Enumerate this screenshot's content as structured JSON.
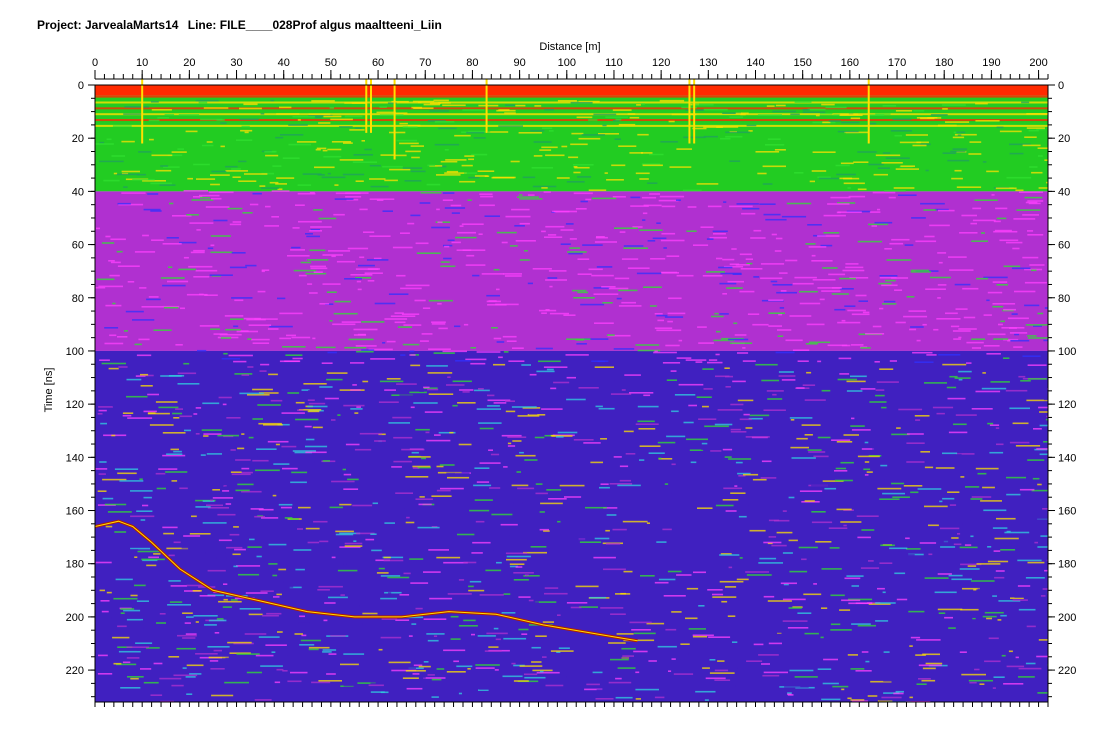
{
  "header": {
    "project": "Project: JarvealaMarts14",
    "line": "Line: FILE____028Prof algus maaltteeni_Liin"
  },
  "chart_data": {
    "type": "heatmap",
    "title": "",
    "xlabel": "Distance [m]",
    "ylabel": "Time [ns]",
    "xlim": [
      0,
      202
    ],
    "ylim": [
      0,
      232
    ],
    "x_ticks": [
      0,
      10,
      20,
      30,
      40,
      50,
      60,
      70,
      80,
      90,
      100,
      110,
      120,
      130,
      140,
      150,
      160,
      170,
      180,
      190,
      200
    ],
    "x_tick_labels": [
      "0",
      "10",
      "20",
      "30",
      "40",
      "50",
      "60",
      "70",
      "80",
      "90",
      "100",
      "110",
      "120",
      "130",
      "140",
      "150",
      "160",
      "170",
      "180",
      "190",
      "200"
    ],
    "y_ticks": [
      0,
      20,
      40,
      60,
      80,
      100,
      120,
      140,
      160,
      180,
      200,
      220
    ],
    "y_tick_labels": [
      "0",
      "20",
      "40",
      "60",
      "80",
      "100",
      "120",
      "140",
      "160",
      "180",
      "200",
      "220"
    ],
    "markers": [
      {
        "x": 10,
        "t_end": 22
      },
      {
        "x": 57.5,
        "t_end": 18
      },
      {
        "x": 58.5,
        "t_end": 18
      },
      {
        "x": 63.5,
        "t_end": 28
      },
      {
        "x": 83,
        "t_end": 18
      },
      {
        "x": 126,
        "t_end": 22
      },
      {
        "x": 127,
        "t_end": 22
      },
      {
        "x": 164,
        "t_end": 22
      }
    ],
    "reflector": [
      {
        "x": 0,
        "t": 166
      },
      {
        "x": 5,
        "t": 164
      },
      {
        "x": 8,
        "t": 166
      },
      {
        "x": 12,
        "t": 172
      },
      {
        "x": 18,
        "t": 182
      },
      {
        "x": 25,
        "t": 190
      },
      {
        "x": 35,
        "t": 194
      },
      {
        "x": 45,
        "t": 198
      },
      {
        "x": 55,
        "t": 200
      },
      {
        "x": 65,
        "t": 200
      },
      {
        "x": 75,
        "t": 198
      },
      {
        "x": 85,
        "t": 199
      },
      {
        "x": 95,
        "t": 203
      },
      {
        "x": 105,
        "t": 206
      },
      {
        "x": 115,
        "t": 209
      }
    ],
    "colors": {
      "near_surface": "#ff2a00",
      "bands": "#ffe000",
      "shallow": "#22cc22",
      "mid": "#b030d0",
      "deep": "#4020c0",
      "noise": "#30e030",
      "marker": "#ffe000"
    },
    "grid": false
  }
}
